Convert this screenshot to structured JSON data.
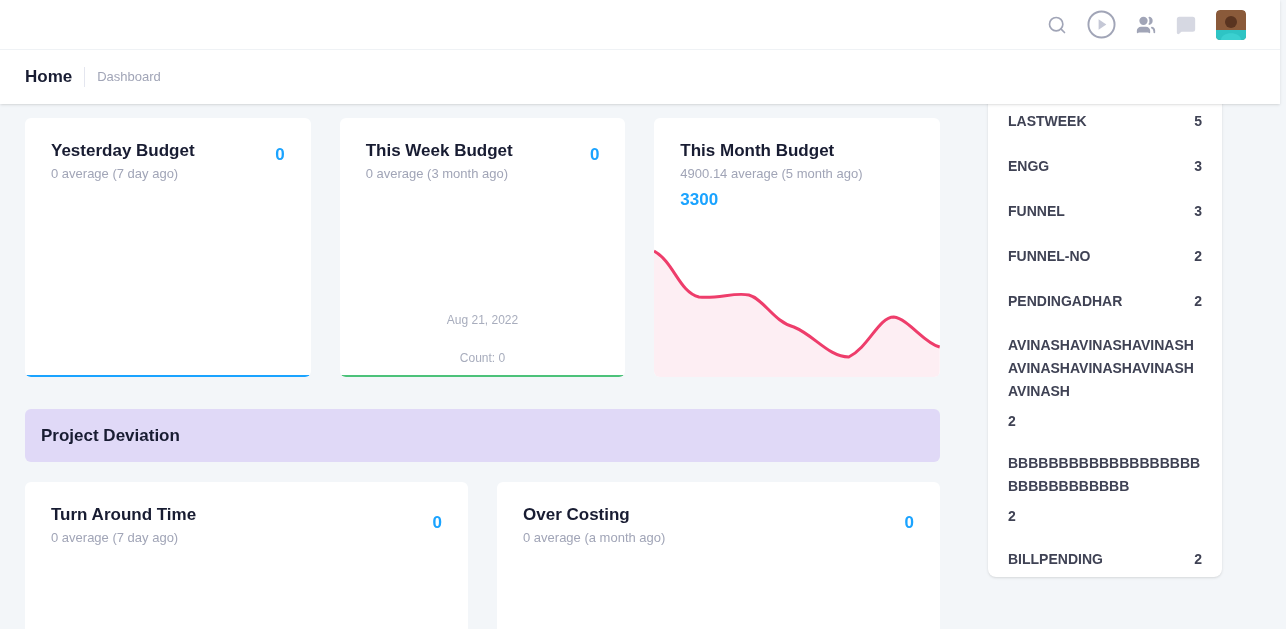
{
  "header": {
    "title": "Home",
    "breadcrumb": "Dashboard"
  },
  "budget_cards": [
    {
      "title": "Yesterday Budget",
      "subtitle": "0 average (7 day ago)",
      "value": "0",
      "kind": "flat",
      "color": "#1aa3ff"
    },
    {
      "title": "This Week Budget",
      "subtitle": "0 average (3 month ago)",
      "value": "0",
      "kind": "flat",
      "color": "#4cc27a",
      "tooltip": {
        "date": "Aug 21, 2022",
        "label": "Count:",
        "count": "0"
      }
    },
    {
      "title": "This Month Budget",
      "subtitle": "4900.14 average (5 month ago)",
      "value": "3300",
      "kind": "area",
      "color": "#ee3d6b"
    }
  ],
  "section": {
    "title": "Project Deviation"
  },
  "deviation_cards": [
    {
      "title": "Turn Around Time",
      "subtitle": "0 average (7 day ago)",
      "value": "0"
    },
    {
      "title": "Over Costing",
      "subtitle": "0 average (a month ago)",
      "value": "0"
    }
  ],
  "side_list": [
    {
      "label": "LASTWEEK",
      "count": "5",
      "kind": "inline"
    },
    {
      "label": "ENGG",
      "count": "3",
      "kind": "inline"
    },
    {
      "label": "FUNNEL",
      "count": "3",
      "kind": "inline"
    },
    {
      "label": "FUNNEL-NO",
      "count": "2",
      "kind": "inline"
    },
    {
      "label": "PENDINGADHAR",
      "count": "2",
      "kind": "inline"
    },
    {
      "label": "AVINASHAVINASHAVINASHAVINASHAVINASHAVINASHAVINASH",
      "count": "2",
      "kind": "stacked"
    },
    {
      "label": "BBBBBBBBBBBBBBBBBBBBBBBBBBBBBBB",
      "count": "2",
      "kind": "stacked"
    },
    {
      "label": "BILLPENDING",
      "count": "2",
      "kind": "inline"
    }
  ]
}
